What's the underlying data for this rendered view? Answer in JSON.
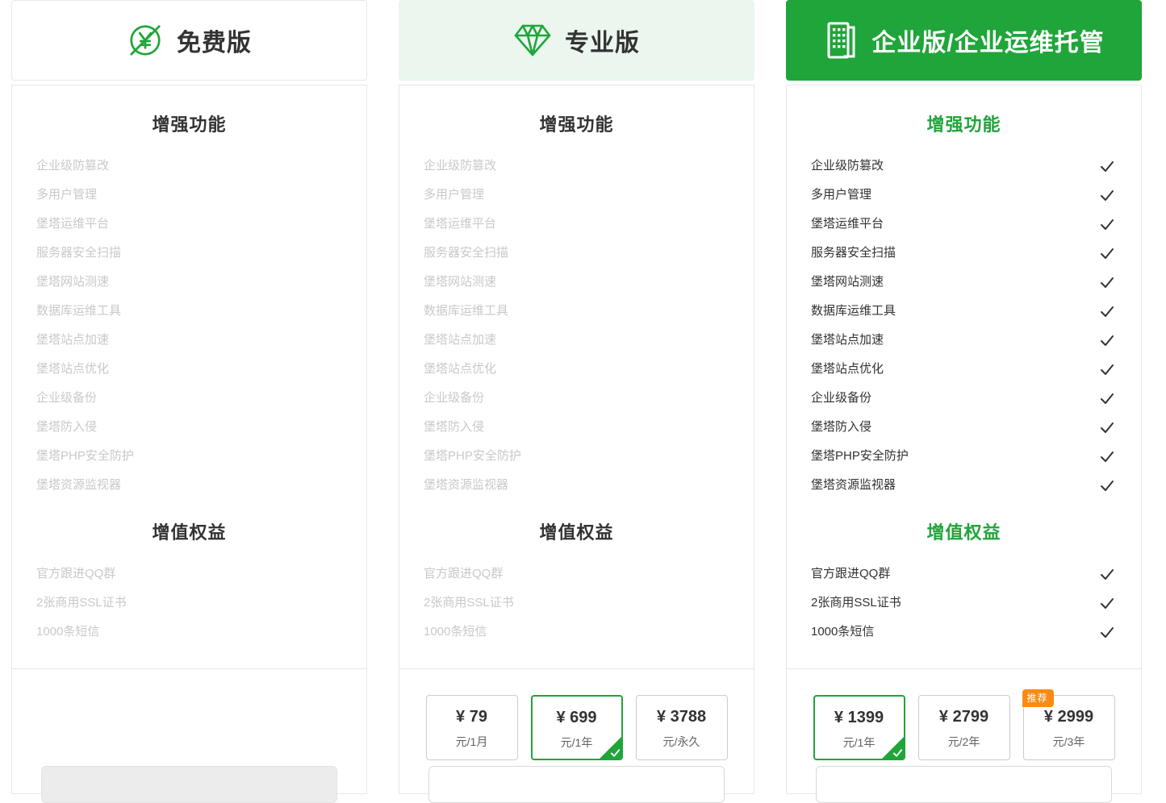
{
  "theme": {
    "green": "#20a53a",
    "light_green_bg": "#eaf6ee",
    "border": "#e8e8e8",
    "muted_text": "#c9c9c9",
    "dark_text": "#333333",
    "badge_orange": "#f98b15"
  },
  "sections": {
    "features_title": "增强功能",
    "benefits_title": "增值权益"
  },
  "features": [
    "企业级防篡改",
    "多用户管理",
    "堡塔运维平台",
    "服务器安全扫描",
    "堡塔网站测速",
    "数据库运维工具",
    "堡塔站点加速",
    "堡塔站点优化",
    "企业级备份",
    "堡塔防入侵",
    "堡塔PHP安全防护",
    "堡塔资源监视器"
  ],
  "benefits": [
    "官方跟进QQ群",
    "2张商用SSL证书",
    "1000条短信"
  ],
  "plans": [
    {
      "id": "free",
      "title": "免费版",
      "icon": "free-no-money-icon",
      "features_included": false,
      "prices": []
    },
    {
      "id": "pro",
      "title": "专业版",
      "icon": "diamond-icon",
      "features_included": false,
      "prices": [
        {
          "amount": "¥ 79",
          "unit": "元/1月",
          "selected": false
        },
        {
          "amount": "¥ 699",
          "unit": "元/1年",
          "selected": true
        },
        {
          "amount": "¥ 3788",
          "unit": "元/永久",
          "selected": false
        }
      ]
    },
    {
      "id": "enterprise",
      "title": "企业版/企业运维托管",
      "icon": "building-icon",
      "features_included": true,
      "prices": [
        {
          "amount": "¥ 1399",
          "unit": "元/1年",
          "selected": true
        },
        {
          "amount": "¥ 2799",
          "unit": "元/2年",
          "selected": false
        },
        {
          "amount": "¥ 2999",
          "unit": "元/3年",
          "selected": false,
          "badge": "推荐"
        }
      ]
    }
  ]
}
